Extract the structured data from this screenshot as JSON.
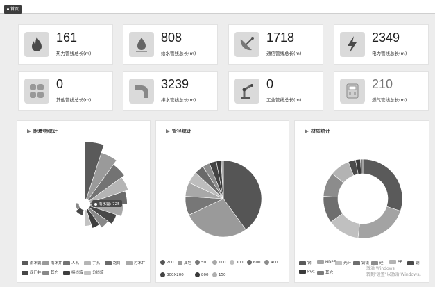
{
  "tab": {
    "label": "首页"
  },
  "stats": [
    {
      "value": "161",
      "label": "热力管线总长(m)",
      "icon": "flame-icon"
    },
    {
      "value": "808",
      "label": "给水管线总长(m)",
      "icon": "water-drop-icon"
    },
    {
      "value": "1718",
      "label": "通信管线总长(m)",
      "icon": "satellite-dish-icon"
    },
    {
      "value": "2349",
      "label": "电力管线总长(m)",
      "icon": "lightning-icon"
    },
    {
      "value": "0",
      "label": "其他管线总长(m)",
      "icon": "grid-icon"
    },
    {
      "value": "3239",
      "label": "排水管线总长(m)",
      "icon": "pipe-elbow-icon"
    },
    {
      "value": "0",
      "label": "工业管线总长(m)",
      "icon": "robot-arm-icon"
    },
    {
      "value": "210",
      "label": "燃气管线总长(m)",
      "icon": "gas-meter-icon"
    }
  ],
  "panels": {
    "attachments": {
      "title": "附着物统计",
      "tooltip": "雨水篦: 725"
    },
    "diameter": {
      "title": "管径统计"
    },
    "material": {
      "title": "材质统计"
    }
  },
  "legends": {
    "attachments": [
      {
        "label": "雨水篦",
        "color": "#5a5a5a"
      },
      {
        "label": "雨水井",
        "color": "#9a9a9a"
      },
      {
        "label": "人孔",
        "color": "#737373"
      },
      {
        "label": "手孔",
        "color": "#b5b5b5"
      },
      {
        "label": "路灯",
        "color": "#6a6a6a"
      },
      {
        "label": "污水井",
        "color": "#a8a8a8"
      },
      {
        "label": "阀门井",
        "color": "#474747"
      },
      {
        "label": "其它",
        "color": "#888888"
      },
      {
        "label": "接线箱",
        "color": "#3e3e3e"
      },
      {
        "label": "分线箱",
        "color": "#c2c2c2"
      }
    ],
    "diameter": [
      {
        "label": "200",
        "color": "#555555"
      },
      {
        "label": "其它",
        "color": "#9a9a9a"
      },
      {
        "label": "50",
        "color": "#777777"
      },
      {
        "label": "100",
        "color": "#a8a8a8"
      },
      {
        "label": "300",
        "color": "#bdbdbd"
      },
      {
        "label": "600",
        "color": "#6a6a6a"
      },
      {
        "label": "400",
        "color": "#8c8c8c"
      },
      {
        "label": "300X200",
        "color": "#444444"
      },
      {
        "label": "800",
        "color": "#3a3a3a"
      },
      {
        "label": "150",
        "color": "#b0b0b0"
      }
    ],
    "material": [
      {
        "label": "钢",
        "color": "#5a5a5a"
      },
      {
        "label": "HDPE",
        "color": "#a3a3a3"
      },
      {
        "label": "光纤",
        "color": "#c0c0c0"
      },
      {
        "label": "铸铁",
        "color": "#6e6e6e"
      },
      {
        "label": "砼",
        "color": "#8c8c8c"
      },
      {
        "label": "PE",
        "color": "#b3b3b3"
      },
      {
        "label": "铜",
        "color": "#4a4a4a"
      },
      {
        "label": "PVC",
        "color": "#3a3a3a"
      },
      {
        "label": "其它",
        "color": "#7a7a7a"
      }
    ]
  },
  "chart_data": [
    {
      "type": "pie",
      "title": "附着物统计",
      "variant": "rose",
      "categories": [
        "雨水篦",
        "雨水井",
        "人孔",
        "手孔",
        "路灯",
        "污水井",
        "阀门井",
        "其它",
        "接线箱",
        "分线箱"
      ],
      "values": [
        725,
        600,
        520,
        470,
        420,
        360,
        280,
        210,
        150,
        100
      ]
    },
    {
      "type": "pie",
      "title": "管径统计",
      "categories": [
        "200",
        "其它",
        "50",
        "100",
        "300",
        "600",
        "400",
        "300X200",
        "800",
        "150"
      ],
      "values": [
        40,
        28,
        8,
        6,
        5,
        4,
        3,
        3,
        2,
        1
      ]
    },
    {
      "type": "pie",
      "title": "材质统计",
      "variant": "donut",
      "categories": [
        "钢",
        "HDPE",
        "光纤",
        "铸铁",
        "砼",
        "PE",
        "铜",
        "PVC",
        "其它"
      ],
      "values": [
        30,
        22,
        13,
        11,
        10,
        8,
        3,
        2,
        1
      ]
    }
  ],
  "watermark": {
    "line1": "激活 Windows",
    "line2": "转到\"设置\"以激活 Windows。"
  }
}
